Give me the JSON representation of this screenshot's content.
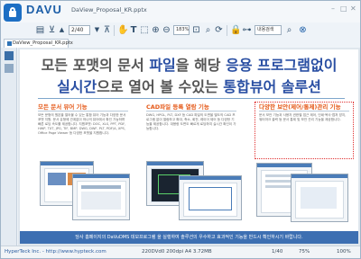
{
  "app": {
    "brand": "DAVU",
    "window_title": "DaView_Proposal_KR.pptx"
  },
  "toolbar": {
    "page_input": "2/40",
    "zoom_value": "183%",
    "search_value": "내용검색"
  },
  "tab": {
    "label": "DaView_Proposal_KR.pptx"
  },
  "document": {
    "headline_line1_a": "모든 포맷의 문서 ",
    "headline_line1_b": "파일",
    "headline_line1_c": "을 해당 ",
    "headline_line1_d": "응용 프로그램없이",
    "headline_line2_a": "실시간",
    "headline_line2_b": "으로 열어 볼 수있는 ",
    "headline_line2_c": "통합뷰어 솔루션",
    "col1_heading": "모든 문서 뷰어 기능",
    "col2_heading": "CAD파일 등록 열람 기능",
    "col3_heading": "다양한 보안(제어/통제)관리 기능",
    "col1_text": "모든 문형의 원본을 열어볼 수 있는 통합 뷰어 기능과 다양한 문서 포맷 지원. 문서 유형에 관계없이 하나의 뷰어에서 확인 가능하며 빠른 로딩 속도를 제공합니다. 지원포맷: DOC, XLS, PPT, PDF, HWP, TXT, JPG, TIF, BMP, DWG, DWF, PLT, PDF/A, XPS, Office Page Viewer 등 다양한 포맷을 지원합니다.",
    "col2_text": "DWG, HPGL, PLT, DXF 등 CAD 파일의 도면을 별도의 CAD 프로그램 없이 열람하고 확대, 축소, 회전, 레이어 제어 등 다양한 기능을 제공합니다. 대용량 도면도 빠르게 로딩하여 실시간 확인이 가능합니다.",
    "col3_text": "문서 보안 기능과 사용자 권한별 접근 제어, 인쇄·복사·캡처 방지, 워터마크 출력 등 문서 통제 및 보안 관리 기능을 제공합니다.",
    "bottom_band": "당사 홈페이지의 DaVuDMS 데모프로그램 을 실행하여 솔루션의 우수하고 효과적인 기능을 반드시 확인하시기 바랍니다."
  },
  "status": {
    "left": "HyperTeck Inc. - http://www.hypteck.com",
    "middle": "220DVd0 200dpi A4 3.72MB",
    "page": "1/40",
    "zoom": "75%",
    "right": "100%"
  },
  "colors": {
    "accent_blue": "#2a4fa3",
    "accent_orange": "#e55a1a",
    "band_blue": "#3d6fb2"
  }
}
